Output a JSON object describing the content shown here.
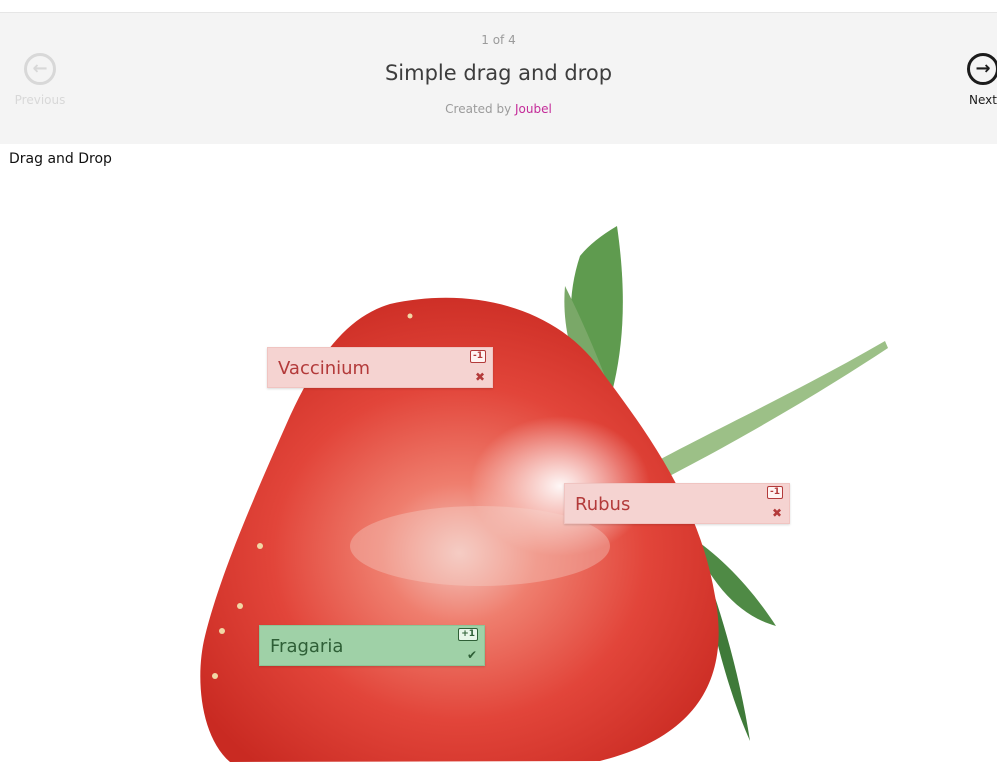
{
  "header": {
    "counter": "1 of 4",
    "title": "Simple drag and drop",
    "created_by_label": "Created by",
    "author": "Joubel",
    "previous_label": "Previous",
    "next_label": "Next",
    "previous_icon": "arrow-left-circle-icon",
    "next_icon": "arrow-right-circle-icon"
  },
  "content": {
    "task_label": "Drag and Drop",
    "image": "strawberry-half-photo",
    "drops": [
      {
        "label": "Vaccinium",
        "score": "-1",
        "status": "wrong",
        "icon": "cross-icon",
        "mark": "✖"
      },
      {
        "label": "Rubus",
        "score": "-1",
        "status": "wrong",
        "icon": "cross-icon",
        "mark": "✖"
      },
      {
        "label": "Fragaria",
        "score": "+1",
        "status": "correct",
        "icon": "check-icon",
        "mark": "✔"
      }
    ]
  },
  "colors": {
    "wrong_bg": "#f5d3d1",
    "wrong_text": "#b33a3a",
    "correct_bg": "#9fd1a7",
    "correct_text": "#2e5f36",
    "author_link": "#c42b99"
  }
}
